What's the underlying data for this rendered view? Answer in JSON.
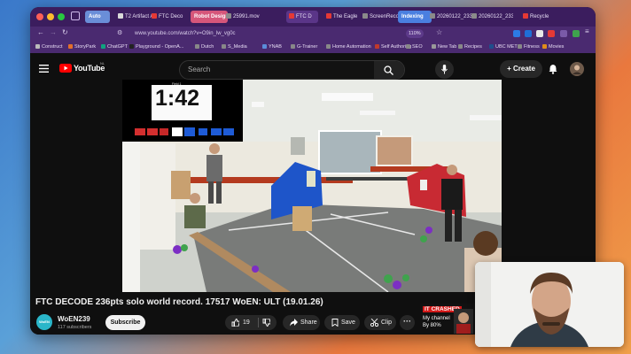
{
  "browser": {
    "tabs": [
      {
        "label": "Auto",
        "group": true,
        "color": "#6a8ed8"
      },
      {
        "label": "T2 Artifact A",
        "fav": "#d9d9d9"
      },
      {
        "label": "FTC Deco",
        "fav": "#e53935"
      },
      {
        "label": "Robot Design",
        "group": true,
        "color": "#d6567a"
      },
      {
        "label": "25991.mov",
        "fav": "#8a8a8a"
      },
      {
        "label": "FTC D",
        "fav": "#e53935",
        "active": true
      },
      {
        "label": "The Eagle",
        "fav": "#e53935"
      },
      {
        "label": "ScreenRecording",
        "fav": "#8a8a8a"
      },
      {
        "label": "Indexing",
        "group": true,
        "color": "#4a7fe0"
      },
      {
        "label": "20260122_23381",
        "fav": "#8a8a8a"
      },
      {
        "label": "20260122_23381",
        "fav": "#8a8a8a"
      },
      {
        "label": "Recycle",
        "fav": "#e53935"
      }
    ],
    "url": "www.youtube.com/watch?v=O9in_lw_vg0c",
    "zoom": "110%",
    "bookmarks": [
      {
        "label": "Construct",
        "color": "#bbbbbb"
      },
      {
        "label": "StoryPark",
        "color": "#e36f2a"
      },
      {
        "label": "ChatGPT",
        "color": "#10a37f"
      },
      {
        "label": "Playground - OpenA...",
        "color": "#222222"
      },
      {
        "label": "Dutch",
        "color": "#888888"
      },
      {
        "label": "S_Media",
        "color": "#888888"
      },
      {
        "label": "YNAB",
        "color": "#5b8dd9"
      },
      {
        "label": "G-Trainer",
        "color": "#888888"
      },
      {
        "label": "Home Automation",
        "color": "#888888"
      },
      {
        "label": "Self Authoring",
        "color": "#c0392b"
      },
      {
        "label": "SEO",
        "color": "#888888"
      },
      {
        "label": "New Tab",
        "color": "#999999"
      },
      {
        "label": "Recipes",
        "color": "#888888"
      },
      {
        "label": "UBC MET",
        "color": "#1f4e8c"
      },
      {
        "label": "Fitness",
        "color": "#888888"
      },
      {
        "label": "Movies",
        "color": "#e08c1a"
      }
    ]
  },
  "youtube": {
    "logo": "YouTube",
    "region": "NL",
    "search_placeholder": "Search",
    "create_label": "Create",
    "video": {
      "scoreboard_time": "1:42",
      "scoreboard_label": "Field 1"
    },
    "title": "FTC DECODE 236pts solo world record. 17517 WoEN: ULT (19.01.26)",
    "channel": "WoEN239",
    "channel_avatar_text": "WoEN",
    "subscribers": "117 subscribers",
    "subscribe_label": "Subscribe",
    "likes": "19",
    "share_label": "Share",
    "save_label": "Save",
    "clip_label": "Clip",
    "thumbnail": {
      "line1": "IT CRASHED",
      "line2": "My channel",
      "line3": "By 80%"
    }
  },
  "colors": {
    "tabbar": "#3b1d5e",
    "youtube_red": "#ff0000",
    "page_bg": "#0f0f0f"
  }
}
